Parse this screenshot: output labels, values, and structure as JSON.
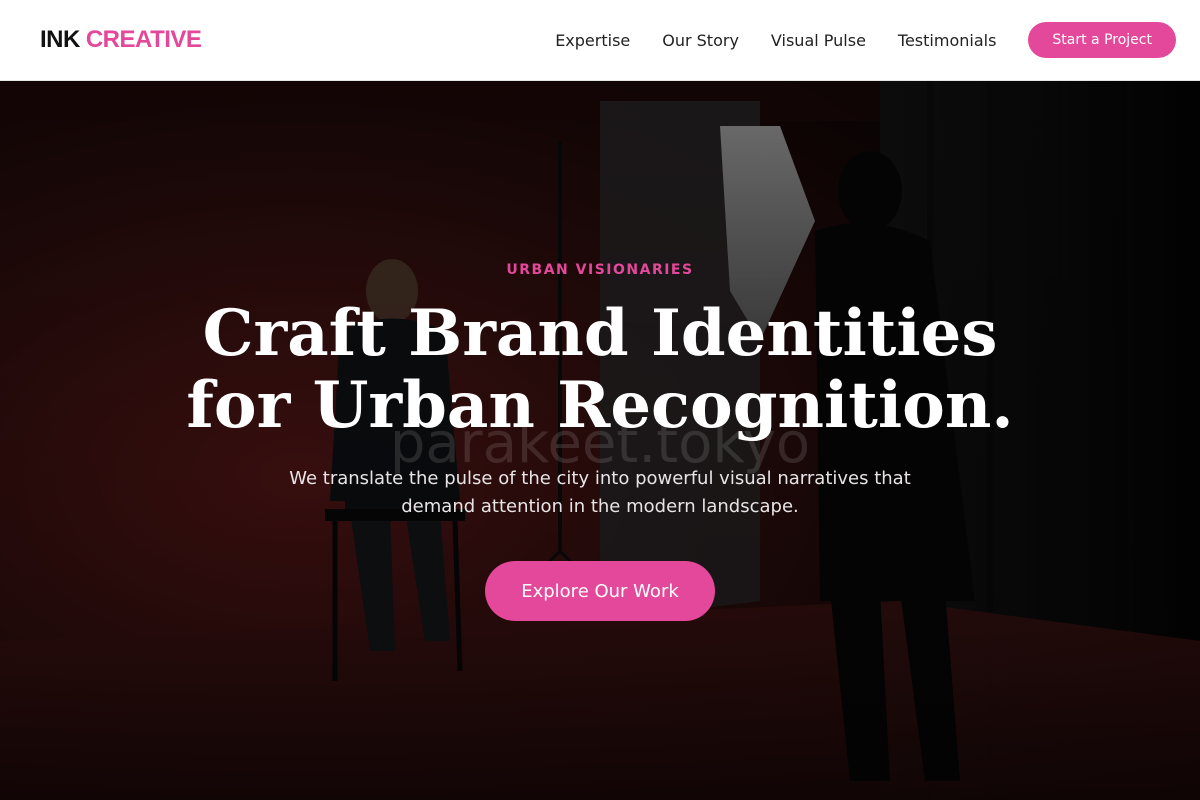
{
  "brand": {
    "name_main": "INK",
    "name_accent": "CREATIVE",
    "accent_color": "#e4489a"
  },
  "nav": {
    "items": [
      "Expertise",
      "Our Story",
      "Visual Pulse",
      "Testimonials"
    ],
    "cta_label": "Start a Project"
  },
  "hero": {
    "eyebrow": "URBAN VISIONARIES",
    "headline_line1": "Craft Brand Identities",
    "headline_line2": "for Urban Recognition.",
    "subtext": "We translate the pulse of the city into powerful visual narratives that demand attention in the modern landscape.",
    "cta_label": "Explore Our Work",
    "watermark": "parakeet.tokyo",
    "background_image": "photo-studio-shoot"
  }
}
